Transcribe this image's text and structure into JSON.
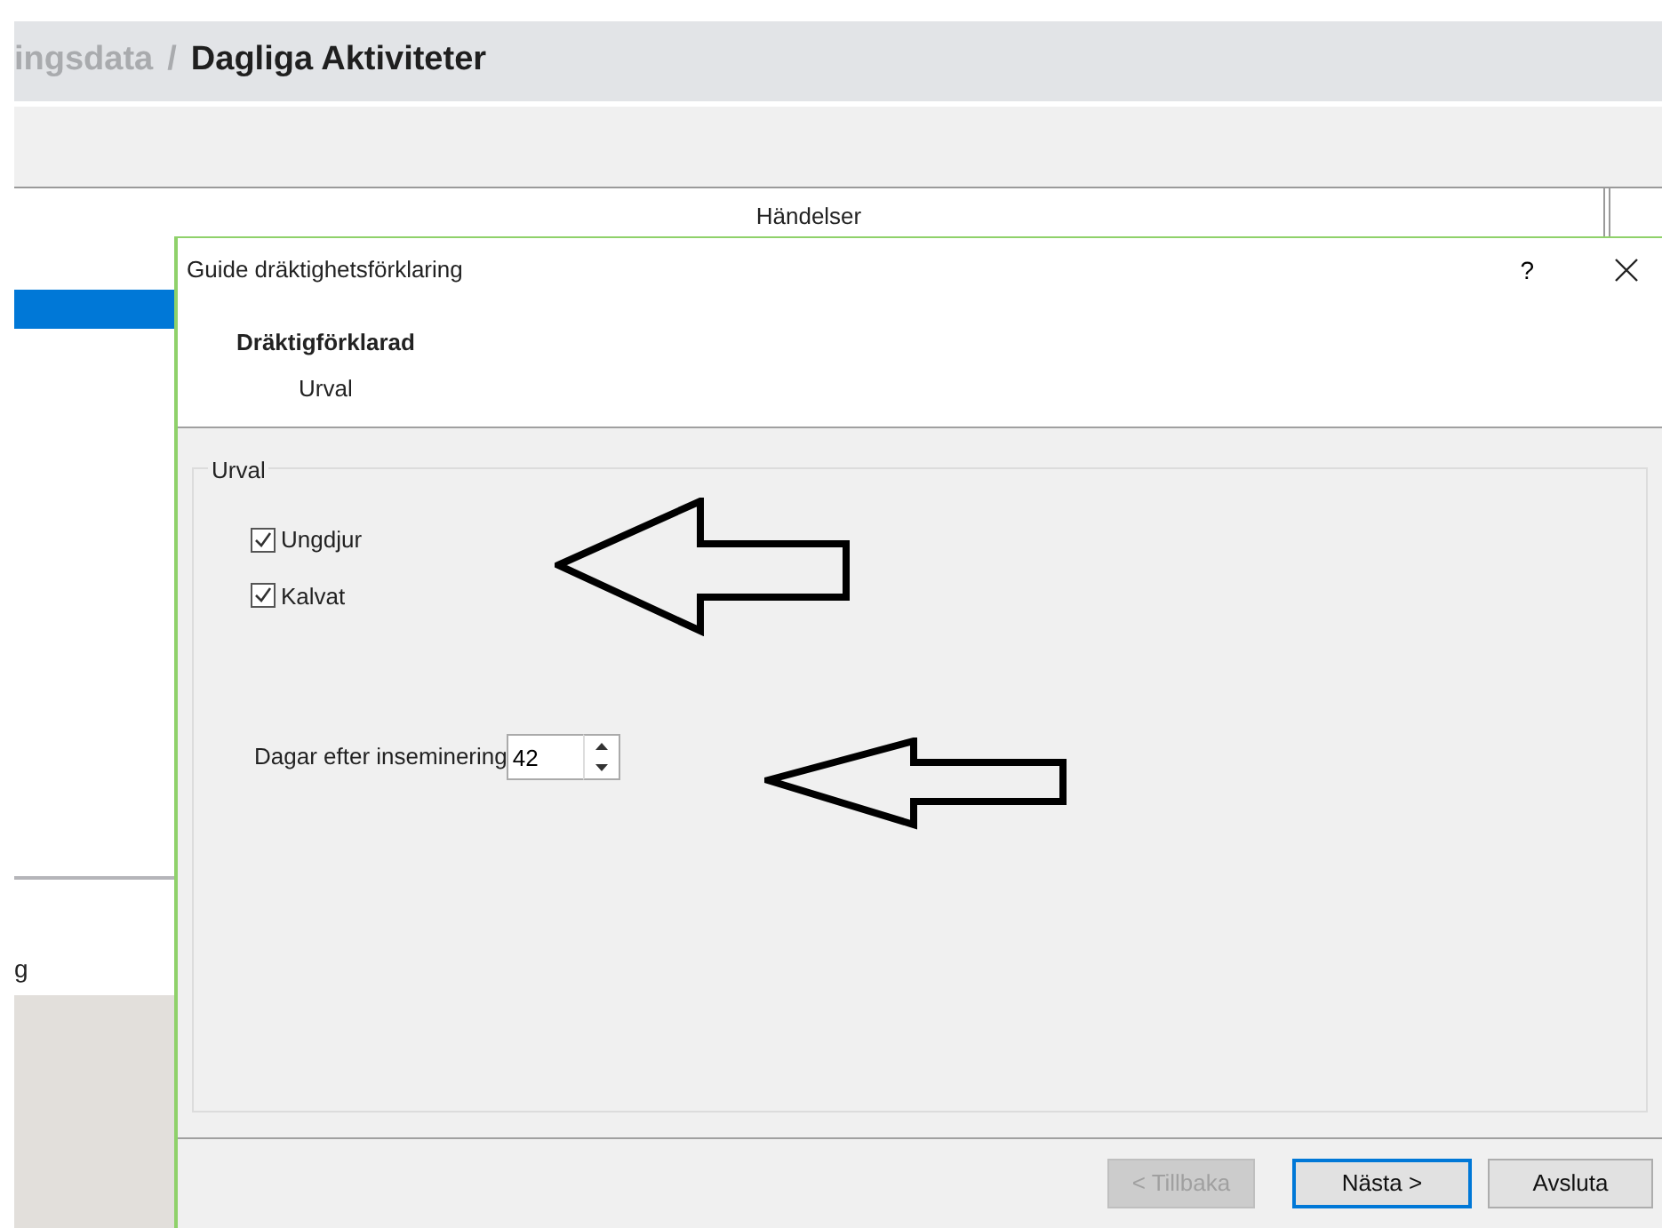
{
  "breadcrumb": {
    "parent": "ingsdata",
    "separator": "/",
    "current": "Dagliga Aktiviteter"
  },
  "background_table": {
    "column_header": "Händelser",
    "rows": [
      {
        "selected": true
      }
    ],
    "footer_text": "g"
  },
  "dialog": {
    "title": "Guide dräktighetsförklaring",
    "help": "?",
    "heading": "Dräktigförklarad",
    "subheading": "Urval",
    "group_title": "Urval",
    "checkboxes": [
      {
        "label": "Ungdjur",
        "checked": true
      },
      {
        "label": "Kalvat",
        "checked": true
      }
    ],
    "spin": {
      "label": "Dagar efter inseminering",
      "value": "42"
    },
    "buttons": [
      {
        "label": "< Tillbaka",
        "disabled": true,
        "default": false
      },
      {
        "label": "Nästa >",
        "disabled": false,
        "default": true
      },
      {
        "label": "Avsluta",
        "disabled": false,
        "default": false
      }
    ]
  }
}
